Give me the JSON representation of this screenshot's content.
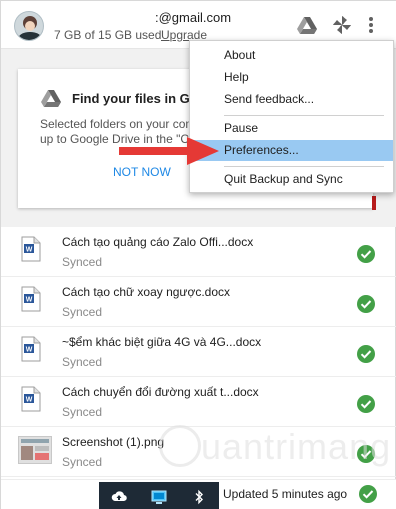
{
  "header": {
    "email": ":@gmail.com",
    "storage": "7 GB of 15 GB used",
    "upgrade_label": "Upgrade"
  },
  "promo": {
    "title": "Find your files in Goo",
    "desc_line1": "Selected folders on your com",
    "desc_line2": "up to Google Drive in the \"C",
    "not_now_label": "NOT NOW"
  },
  "menu": {
    "items": [
      {
        "label": "About"
      },
      {
        "label": "Help"
      },
      {
        "label": "Send feedback..."
      },
      {
        "label": "Pause"
      },
      {
        "label": "Preferences..."
      },
      {
        "label": "Quit Backup and Sync"
      }
    ],
    "selected": "Preferences..."
  },
  "files": [
    {
      "name": "Cách tạo quảng cáo Zalo Offi...docx",
      "status": "Synced",
      "type": "word-doc-icon"
    },
    {
      "name": "Cách tạo chữ xoay ngược.docx",
      "status": "Synced",
      "type": "word-doc-icon"
    },
    {
      "name": "~$ểm khác biệt giữa 4G và 4G...docx",
      "status": "Synced",
      "type": "word-doc-icon"
    },
    {
      "name": "Cách chuyển đổi đường xuất t...docx",
      "status": "Synced",
      "type": "word-doc-icon"
    },
    {
      "name": "Screenshot (1).png",
      "status": "Synced",
      "type": "image-thumbnail"
    }
  ],
  "footer": {
    "status": "Updated 5 minutes ago"
  },
  "watermark": "uantrimang",
  "colors": {
    "accent_blue": "#1e88e5",
    "check_green": "#43a047",
    "menu_highlight": "#99c9f2",
    "arrow_red": "#e53935"
  }
}
